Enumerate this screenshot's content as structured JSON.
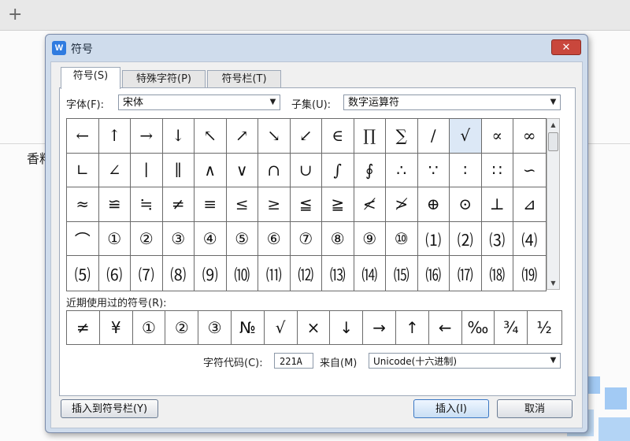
{
  "background": {
    "new_tab_glyph": "+",
    "doc_text": "香料"
  },
  "dialog": {
    "app_icon": "W",
    "title": "符号",
    "close_glyph": "✕",
    "tabs": [
      {
        "label": "符号(S)"
      },
      {
        "label": "特殊字符(P)"
      },
      {
        "label": "符号栏(T)"
      }
    ],
    "font_label": "字体(F):",
    "font_value": "宋体",
    "subset_label": "子集(U):",
    "subset_value": "数字运算符",
    "symbols": [
      "←",
      "↑",
      "→",
      "↓",
      "↖",
      "↗",
      "↘",
      "↙",
      "∈",
      "∏",
      "∑",
      "∕",
      "√",
      "∝",
      "∞",
      "∟",
      "∠",
      "∣",
      "∥",
      "∧",
      "∨",
      "∩",
      "∪",
      "∫",
      "∮",
      "∴",
      "∵",
      "∶",
      "∷",
      "∽",
      "≈",
      "≌",
      "≒",
      "≠",
      "≡",
      "≤",
      "≥",
      "≦",
      "≧",
      "≮",
      "≯",
      "⊕",
      "⊙",
      "⊥",
      "⊿",
      "⌒",
      "①",
      "②",
      "③",
      "④",
      "⑤",
      "⑥",
      "⑦",
      "⑧",
      "⑨",
      "⑩",
      "⑴",
      "⑵",
      "⑶",
      "⑷",
      "⑸",
      "⑹",
      "⑺",
      "⑻",
      "⑼",
      "⑽",
      "⑾",
      "⑿",
      "⒀",
      "⒁",
      "⒂",
      "⒃",
      "⒄",
      "⒅",
      "⒆"
    ],
    "selected_symbol": "√",
    "recent_label": "近期使用过的符号(R):",
    "recent_symbols": [
      "≠",
      "¥",
      "①",
      "②",
      "③",
      "№",
      "√",
      "×",
      "↓",
      "→",
      "↑",
      "←",
      "‰",
      "¾",
      "½"
    ],
    "char_code_label": "字符代码(C):",
    "char_code_value": "221A",
    "from_label": "来自(M)",
    "from_value": "Unicode(十六进制)",
    "insert_to_bar_button": "插入到符号栏(Y)",
    "insert_button": "插入(I)",
    "cancel_button": "取消"
  }
}
